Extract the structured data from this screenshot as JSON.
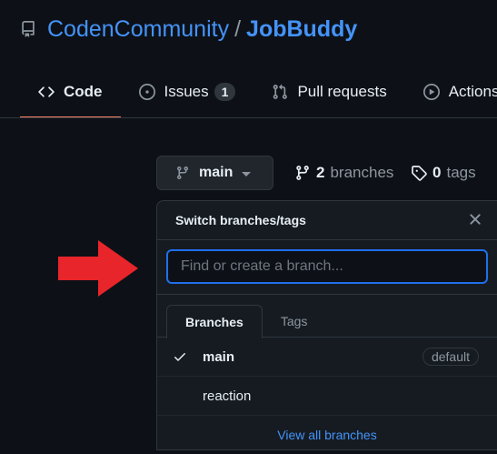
{
  "repo": {
    "owner": "CodenCommunity",
    "separator": "/",
    "name": "JobBuddy",
    "icon": "repo-icon"
  },
  "tabs": [
    {
      "label": "Code",
      "icon": "code-icon",
      "selected": true
    },
    {
      "label": "Issues",
      "icon": "issue-opened-icon",
      "count": "1"
    },
    {
      "label": "Pull requests",
      "icon": "git-pull-request-icon"
    },
    {
      "label": "Actions",
      "icon": "play-icon"
    }
  ],
  "branch_button": {
    "label": "main",
    "icon": "git-branch-icon"
  },
  "branches_link": {
    "count": "2",
    "label": "branches",
    "icon": "git-branch-icon"
  },
  "tags_link": {
    "count": "0",
    "label": "tags",
    "icon": "tag-icon"
  },
  "dropdown": {
    "title": "Switch branches/tags",
    "filter": {
      "placeholder": "Find or create a branch...",
      "value": ""
    },
    "tabs": [
      {
        "label": "Branches",
        "active": true
      },
      {
        "label": "Tags",
        "active": false
      }
    ],
    "items": [
      {
        "label": "main",
        "checked": true,
        "badge": "default"
      },
      {
        "label": "reaction",
        "checked": false
      }
    ],
    "footer_link": "View all branches"
  },
  "annotation": {
    "type": "arrow",
    "color": "#e8252a",
    "direction": "right"
  },
  "colors": {
    "accent": "#4493f8",
    "tab_underline": "#f78166",
    "focus_border": "#1f6feb",
    "background": "#0d1117"
  }
}
